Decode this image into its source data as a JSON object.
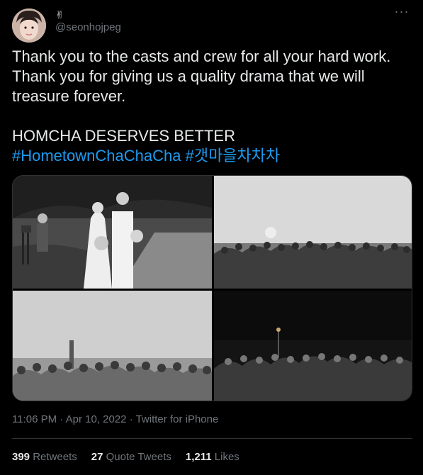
{
  "user": {
    "display_name": "✌",
    "handle": "@seonhojpeg"
  },
  "tweet": {
    "line1": "Thank you to the casts and crew for all your hard work. Thank you for giving us a quality drama that we will treasure forever.",
    "line2": "HOMCHA DESERVES BETTER",
    "hashtag1": "#HometownChaChaCha",
    "hashtag2": "#갯마을차차차"
  },
  "media": {
    "count": 4
  },
  "meta": {
    "time": "11:06 PM",
    "separator": "·",
    "date": "Apr 10, 2022",
    "source": "Twitter for iPhone"
  },
  "stats": {
    "retweets_count": "399",
    "retweets_label": "Retweets",
    "quotes_count": "27",
    "quotes_label": "Quote Tweets",
    "likes_count": "1,211",
    "likes_label": "Likes"
  },
  "colors": {
    "background": "#000000",
    "text": "#e7e9ea",
    "secondary": "#71767b",
    "link": "#1d9bf0",
    "border": "#2f3336"
  }
}
